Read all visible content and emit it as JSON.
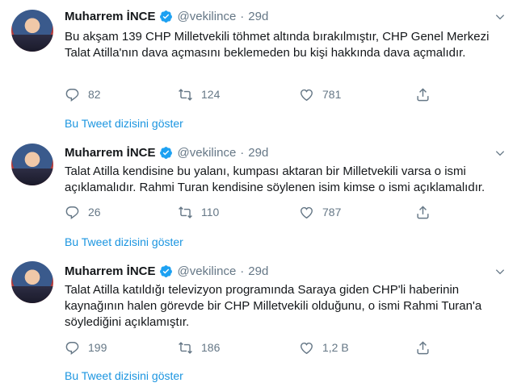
{
  "tweets": [
    {
      "name": "Muharrem İNCE",
      "handle": "@vekilince",
      "dot": "·",
      "time": "29d",
      "text": "Bu akşam 139 CHP Milletvekili töhmet altında bırakılmıştır, CHP Genel Merkezi Talat Atilla'nın dava açmasını beklemeden bu kişi hakkında dava açmalıdır.",
      "replies": "82",
      "retweets": "124",
      "likes": "781",
      "show_thread": "Bu Tweet dizisini göster"
    },
    {
      "name": "Muharrem İNCE",
      "handle": "@vekilince",
      "dot": "·",
      "time": "29d",
      "text": "Talat Atilla kendisine bu yalanı, kumpası aktaran bir Milletvekili varsa o ismi açıklamalıdır. Rahmi Turan kendisine söylenen isim kimse o ismi açıklamalıdır.",
      "replies": "26",
      "retweets": "110",
      "likes": "787",
      "show_thread": "Bu Tweet dizisini göster"
    },
    {
      "name": "Muharrem İNCE",
      "handle": "@vekilince",
      "dot": "·",
      "time": "29d",
      "text": "Talat Atilla katıldığı televizyon programında Saraya giden CHP'li haberinin kaynağının halen görevde bir CHP Milletvekili olduğunu, o ismi Rahmi Turan'a söylediğini açıklamıştır.",
      "replies": "199",
      "retweets": "186",
      "likes": "1,2 B",
      "show_thread": "Bu Tweet dizisini göster"
    }
  ],
  "colors": {
    "accent": "#1b95e0",
    "muted": "#657786",
    "text": "#14171a",
    "verified": "#1da1f2"
  },
  "icons": {
    "reply": "reply-icon",
    "retweet": "retweet-icon",
    "like": "heart-icon",
    "share": "share-icon",
    "verified": "verified-badge-icon",
    "caret": "chevron-down-icon"
  }
}
